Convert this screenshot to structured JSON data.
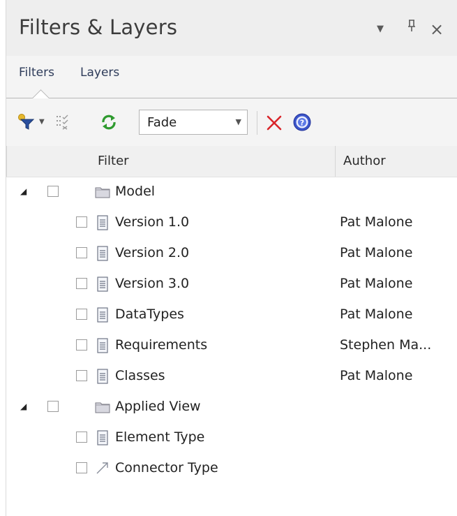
{
  "window": {
    "title": "Filters & Layers",
    "controls": {
      "dropdown": "▼",
      "pin": "ᵖ",
      "close": "×"
    }
  },
  "tabs": [
    {
      "label": "Filters",
      "active": true
    },
    {
      "label": "Layers",
      "active": false
    }
  ],
  "toolbar": {
    "mode_value": "Fade",
    "icons": [
      "filter-add-icon",
      "dropdown-arrow-icon",
      "select-filters-icon",
      "refresh-icon",
      "delete-icon",
      "help-icon"
    ]
  },
  "columns": {
    "filter": "Filter",
    "author": "Author"
  },
  "tree": {
    "groups": [
      {
        "name": "Model",
        "expanded": true,
        "icon": "folder-icon",
        "items": [
          {
            "name": "Version 1.0",
            "author": "Pat Malone",
            "icon": "document-icon"
          },
          {
            "name": "Version 2.0",
            "author": "Pat Malone",
            "icon": "document-icon"
          },
          {
            "name": "Version 3.0",
            "author": "Pat Malone",
            "icon": "document-icon"
          },
          {
            "name": "DataTypes",
            "author": "Pat Malone",
            "icon": "document-icon"
          },
          {
            "name": "Requirements",
            "author": "Stephen Ma...",
            "icon": "document-icon"
          },
          {
            "name": "Classes",
            "author": "Pat Malone",
            "icon": "document-icon"
          }
        ]
      },
      {
        "name": "Applied View",
        "expanded": true,
        "icon": "folder-icon",
        "items": [
          {
            "name": "Element Type",
            "author": "",
            "icon": "document-icon"
          },
          {
            "name": "Connector Type",
            "author": "",
            "icon": "connector-arrow-icon"
          }
        ]
      }
    ]
  },
  "colors": {
    "title_bg": "#eeeeee",
    "tab_text": "#2e3c5a",
    "delete_red": "#d9252a",
    "help_blue": "#3b55c9",
    "refresh_green": "#2e9a2e",
    "filter_gold": "#d8a92a"
  }
}
